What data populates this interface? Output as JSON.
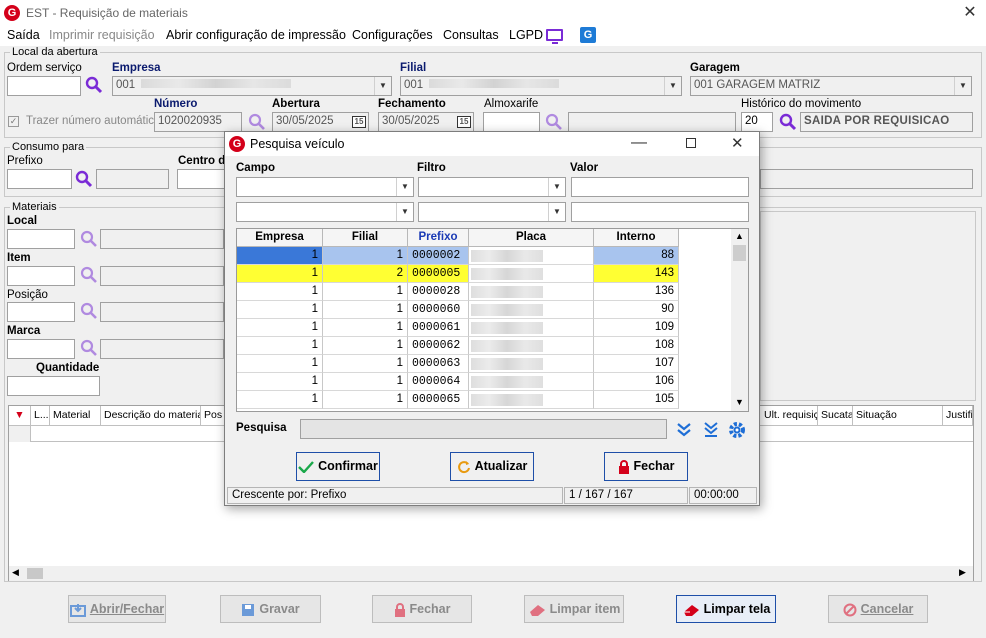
{
  "window": {
    "title": "EST - Requisição de materiais",
    "close": "✕",
    "app_icon_letter": "G"
  },
  "menu": [
    "Saída",
    "Imprimir requisição",
    "Abrir configuração de impressão",
    "Configurações",
    "Consultas",
    "LGPD"
  ],
  "menu_g_icon": "G",
  "local": {
    "group": "Local da abertura",
    "ordem_label": "Ordem serviço",
    "ordem_value": "",
    "empresa_label": "Empresa",
    "empresa_value": "001",
    "filial_label": "Filial",
    "filial_value": "001",
    "garagem_label": "Garagem",
    "garagem_value": "001 GARAGEM MATRIZ",
    "trazer_label": "Trazer número automático",
    "numero_label": "Número",
    "numero_value": "1020020935",
    "abertura_label": "Abertura",
    "abertura_value": "30/05/2025",
    "fechamento_label": "Fechamento",
    "fechamento_value": "30/05/2025",
    "almox_label": "Almoxarife",
    "historico_label": "Histórico do movimento",
    "historico_code": "20",
    "historico_desc": "SAIDA POR REQUISICAO",
    "cal": "15"
  },
  "consumo": {
    "group": "Consumo para",
    "prefixo_label": "Prefixo",
    "centro_label": "Centro d"
  },
  "materiais": {
    "group": "Materiais",
    "local_label": "Local",
    "item_label": "Item",
    "posicao_label": "Posição",
    "marca_label": "Marca",
    "quantidade_label": "Quantidade"
  },
  "grid": {
    "headers_left": [
      "L...",
      "Material",
      "Descrição do material",
      "Pos"
    ],
    "headers_right": [
      "Ult. requisição",
      "Sucata",
      "Situação",
      "Justifi"
    ]
  },
  "buttons": {
    "abrir": "Abrir/Fechar",
    "gravar": "Gravar",
    "fechar": "Fechar",
    "limpar_item": "Limpar item",
    "limpar_tela": "Limpar tela",
    "cancelar": "Cancelar"
  },
  "dialog": {
    "title": "Pesquisa veículo",
    "icon_letter": "G",
    "campo_label": "Campo",
    "filtro_label": "Filtro",
    "valor_label": "Valor",
    "columns": [
      "Empresa",
      "Filial",
      "Prefixo",
      "Placa",
      "Interno"
    ],
    "rows": [
      {
        "empresa": "1",
        "filial": "1",
        "prefixo": "0000002",
        "interno": "88"
      },
      {
        "empresa": "1",
        "filial": "2",
        "prefixo": "0000005",
        "interno": "143"
      },
      {
        "empresa": "1",
        "filial": "1",
        "prefixo": "0000028",
        "interno": "136"
      },
      {
        "empresa": "1",
        "filial": "1",
        "prefixo": "0000060",
        "interno": "90"
      },
      {
        "empresa": "1",
        "filial": "1",
        "prefixo": "0000061",
        "interno": "109"
      },
      {
        "empresa": "1",
        "filial": "1",
        "prefixo": "0000062",
        "interno": "108"
      },
      {
        "empresa": "1",
        "filial": "1",
        "prefixo": "0000063",
        "interno": "107"
      },
      {
        "empresa": "1",
        "filial": "1",
        "prefixo": "0000064",
        "interno": "106"
      },
      {
        "empresa": "1",
        "filial": "1",
        "prefixo": "0000065",
        "interno": "105"
      }
    ],
    "pesquisa_label": "Pesquisa",
    "confirmar": "Confirmar",
    "atualizar": "Atualizar",
    "fechar": "Fechar",
    "status_sort": "Crescente por: Prefixo",
    "status_count": "1 / 167 / 167",
    "status_time": "00:00:00"
  },
  "colors": {
    "accent_purple": "#7a2bd6",
    "brand_red": "#d4001a",
    "selected_row": "#a8c4ee",
    "highlight_row": "#ffff33"
  }
}
